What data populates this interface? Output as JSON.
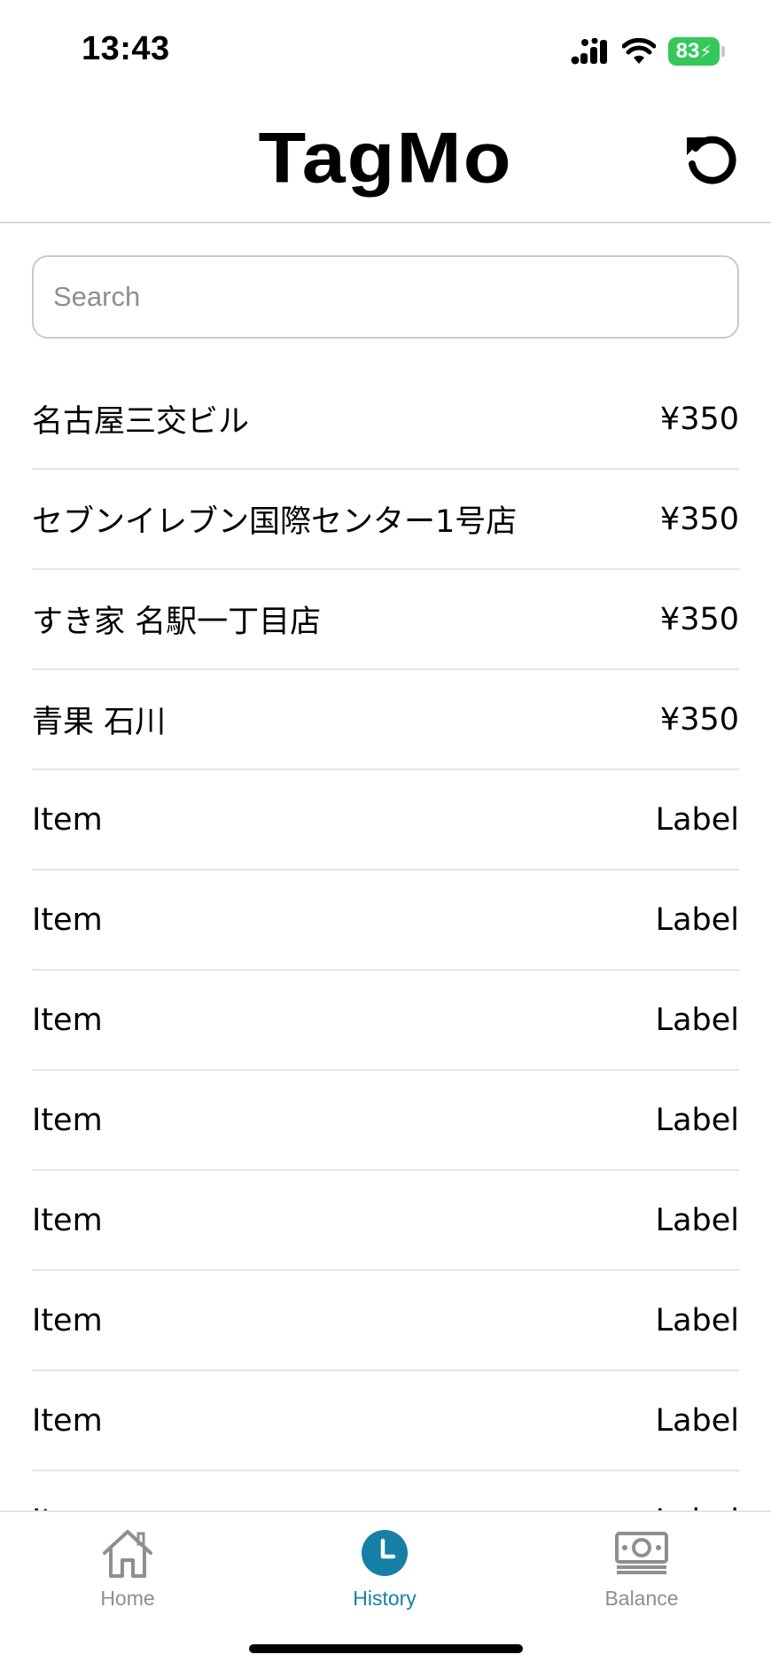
{
  "status_bar": {
    "time": "13:43",
    "battery_level": "83",
    "battery_charging": true
  },
  "header": {
    "title": "TagMo",
    "refresh_icon": "refresh-icon"
  },
  "search": {
    "placeholder": "Search",
    "value": ""
  },
  "list": {
    "items": [
      {
        "name": "名古屋三交ビル",
        "value": "¥350"
      },
      {
        "name": "セブンイレブン国際センター1号店",
        "value": "¥350"
      },
      {
        "name": "すき家 名駅一丁目店",
        "value": "¥350"
      },
      {
        "name": "青果 石川",
        "value": "¥350"
      },
      {
        "name": "Item",
        "value": "Label"
      },
      {
        "name": "Item",
        "value": "Label"
      },
      {
        "name": "Item",
        "value": "Label"
      },
      {
        "name": "Item",
        "value": "Label"
      },
      {
        "name": "Item",
        "value": "Label"
      },
      {
        "name": "Item",
        "value": "Label"
      },
      {
        "name": "Item",
        "value": "Label"
      },
      {
        "name": "Item",
        "value": "Label"
      }
    ]
  },
  "tab_bar": {
    "tabs": [
      {
        "label": "Home",
        "icon": "home-icon",
        "active": false
      },
      {
        "label": "History",
        "icon": "history-icon",
        "active": true
      },
      {
        "label": "Balance",
        "icon": "balance-icon",
        "active": false
      }
    ]
  },
  "colors": {
    "accent": "#157fa6",
    "inactive": "#8e8e93",
    "battery": "#34c759",
    "divider": "#e5e5e5"
  }
}
